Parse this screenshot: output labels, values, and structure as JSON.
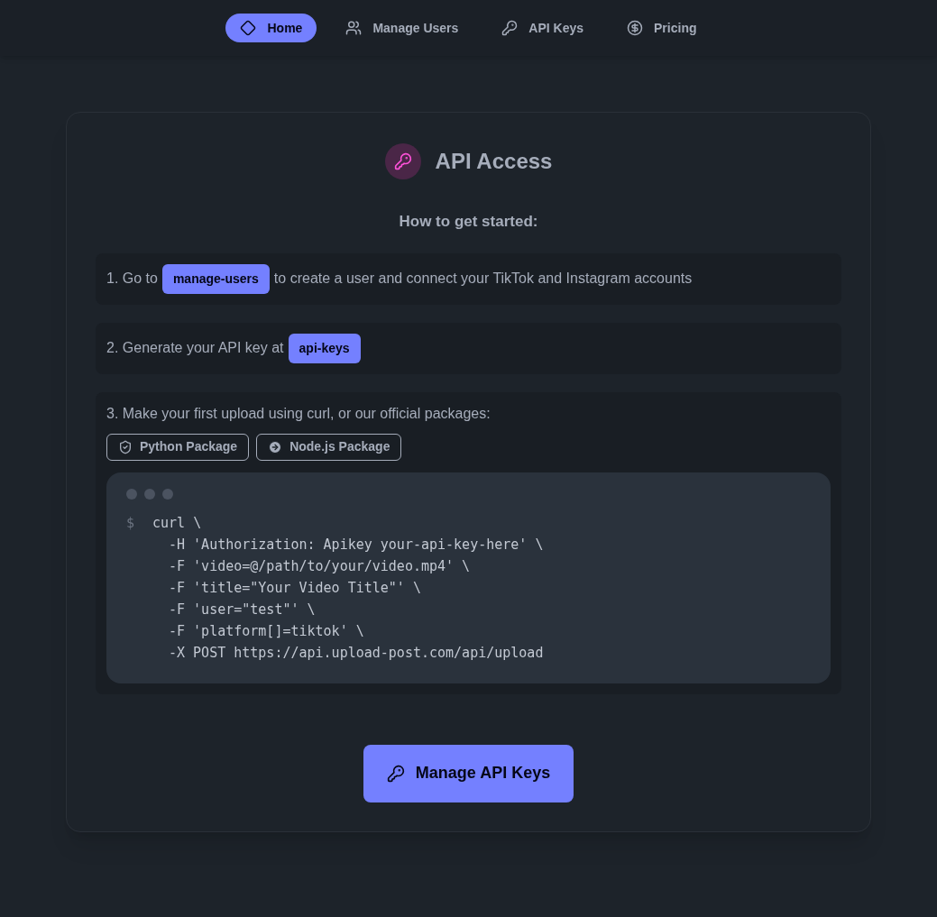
{
  "nav": [
    {
      "label": "Home",
      "selected": true
    },
    {
      "label": "Manage Users",
      "selected": false
    },
    {
      "label": "API Keys",
      "selected": false
    },
    {
      "label": "Pricing",
      "selected": false
    }
  ],
  "title": "API Access",
  "subtitle": "How to get started:",
  "steps": [
    {
      "before": "1. Go to",
      "link": "manage-users",
      "after": "to create a user and connect your TikTok and Instagram accounts"
    },
    {
      "before": "2. Generate your API key at",
      "link": "api-keys"
    },
    {
      "before": "3. Make your first upload using curl, or our official packages:",
      "packages": [
        {
          "label": "Python Package"
        },
        {
          "label": "Node.js Package"
        }
      ],
      "code": {
        "prompt": "$",
        "lines": [
          "curl \\",
          "-H 'Authorization: Apikey your-api-key-here' \\",
          "-F 'video=@/path/to/your/video.mp4' \\",
          "-F 'title=\"Your Video Title\"' \\",
          "-F 'user=\"test\"' \\",
          "-F 'platform[]=tiktok' \\",
          "-X POST https://api.upload-post.com/api/upload"
        ]
      }
    }
  ],
  "action": "Manage API Keys"
}
